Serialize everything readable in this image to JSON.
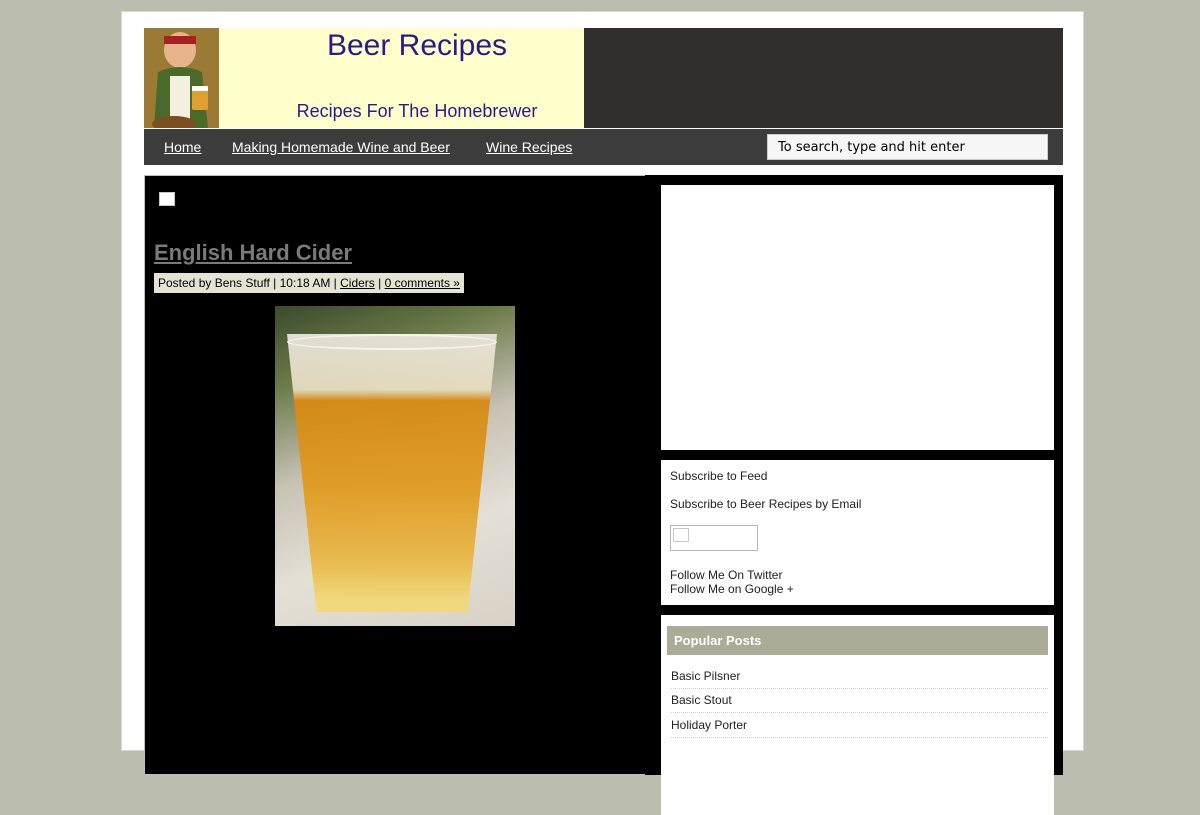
{
  "header": {
    "title": "Beer Recipes",
    "tagline": "Recipes For The Homebrewer"
  },
  "nav": {
    "items": [
      {
        "label": "Home"
      },
      {
        "label": "Making Homemade Wine and Beer"
      },
      {
        "label": "Wine Recipes"
      }
    ],
    "search_placeholder": "To search, type and hit enter"
  },
  "post": {
    "title": "English Hard Cider",
    "meta_prefix": "Posted by Bens Stuff | 10:18 AM | ",
    "category": "Ciders",
    "separator": " | ",
    "comments": "0 comments »"
  },
  "sidebar": {
    "subscribe_feed": "Subscribe to Feed",
    "subscribe_email": "Subscribe to Beer Recipes by Email",
    "follow_twitter": "Follow Me On Twitter",
    "follow_google": "Follow Me on Google +",
    "popular_title": "Popular Posts",
    "popular_posts": [
      {
        "label": "Basic Pilsner"
      },
      {
        "label": "Basic Stout"
      },
      {
        "label": "Holiday Porter"
      }
    ]
  }
}
